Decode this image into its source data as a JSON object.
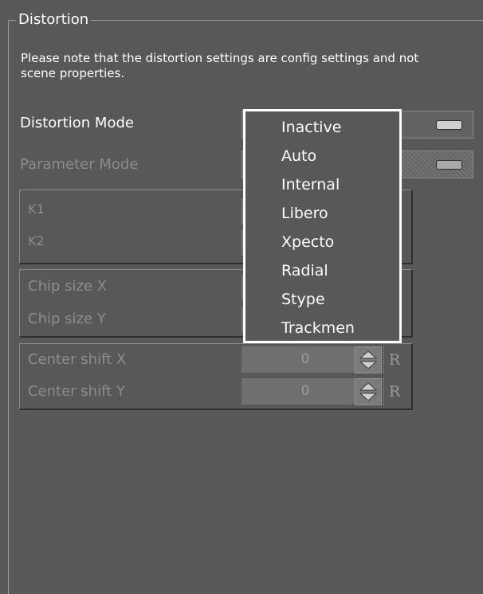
{
  "group": {
    "title": "Distortion"
  },
  "note": "Please note that the distortion settings are config settings and not scene properties.",
  "distortion_mode": {
    "label": "Distortion Mode"
  },
  "parameter_mode": {
    "label": "Parameter Mode"
  },
  "k_box": {
    "k1_label": "K1",
    "k2_label": "K2"
  },
  "chip_box": {
    "x_label": "Chip size X",
    "y_label": "Chip size Y"
  },
  "center_box": {
    "x_label": "Center shift X",
    "x_value": "0",
    "y_label": "Center shift Y",
    "y_value": "0",
    "reset_label": "R"
  },
  "dropdown": {
    "options": [
      "Inactive",
      "Auto",
      "Internal",
      "Libero",
      "Xpecto",
      "Radial",
      "Stype",
      "Trackmen"
    ]
  },
  "colors": {
    "background": "#585858",
    "text": "#ffffff",
    "disabled_text": "#8c8c8c",
    "popup_border": "#ffffff"
  }
}
